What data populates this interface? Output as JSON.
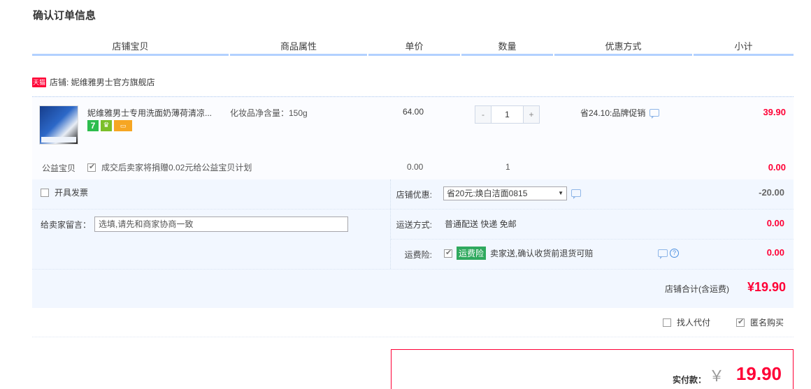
{
  "page": {
    "title": "确认订单信息"
  },
  "columns": [
    "店铺宝贝",
    "商品属性",
    "单价",
    "数量",
    "优惠方式",
    "小计"
  ],
  "shop": {
    "badge": "天猫",
    "label": "店铺: 妮维雅男士官方旗舰店"
  },
  "item": {
    "name": "妮维雅男士专用洗面奶薄荷清凉...",
    "spec": "化妆品净含量：150g",
    "service_icons": [
      "seven-day-return-icon",
      "guarantee-icon",
      "card-payment-icon"
    ],
    "price": "64.00",
    "quantity": "1",
    "qty_minus": "-",
    "qty_plus": "+",
    "promo": "省24.10:品牌促销",
    "subtotal": "39.90"
  },
  "charity": {
    "label": "公益宝贝",
    "text": "成交后卖家将捐赠0.02元给公益宝贝计划",
    "price": "0.00",
    "quantity": "1",
    "subtotal": "0.00",
    "checked": true
  },
  "invoice": {
    "label": "开具发票",
    "checked": false
  },
  "memo": {
    "label": "给卖家留言：",
    "placeholder": "选填,请先和商家协商一致"
  },
  "shop_discount": {
    "label": "店铺优惠:",
    "selected": "省20元:焕白洁面0815",
    "value": "-20.00"
  },
  "shipping": {
    "label": "运送方式:",
    "text": "普通配送 快递 免邮",
    "value": "0.00"
  },
  "insurance": {
    "label": "运费险:",
    "tag": "运费险",
    "text": "卖家送,确认收货前退货可赔",
    "value": "0.00",
    "checked": true
  },
  "shop_total": {
    "label": "店铺合计(含运费)",
    "value": "¥19.90"
  },
  "options": {
    "proxy_pay": "找人代付",
    "proxy_checked": false,
    "anonymous": "匿名购买",
    "anonymous_checked": true
  },
  "payment": {
    "label": "实付款：",
    "currency": "￥",
    "value": "19.90"
  },
  "colors": {
    "accent_red": "#ff0036",
    "header_line": "#b2d1ff",
    "tag_green": "#2fa95e"
  }
}
